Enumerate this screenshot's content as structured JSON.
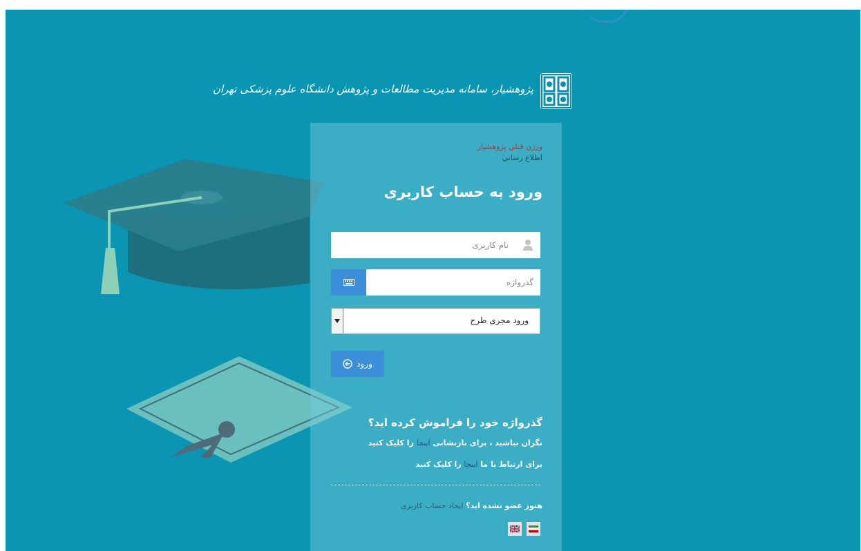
{
  "header": {
    "site_title": "پژوهشیار، سامانه مدیریت مطالعات و پژوهش دانشگاه علوم پزشکی تهران",
    "logo_icon": "university-logo-icon"
  },
  "login": {
    "previous_version_link": "ورژن قبلی پژوهشیار",
    "info_link": "اطلاع رسانی",
    "title": "ورود به حساب کاربری",
    "username_placeholder": "نام کاربری",
    "password_placeholder": "گذرواژه",
    "role_select_value": "ورود مجری طرح",
    "submit_label": "ورود"
  },
  "forgot": {
    "title": "گذرواژه خود را فراموش کرده اید؟",
    "restore_prefix": "نگران نباشید ، برای بازنشانی ",
    "restore_link": "اینجا",
    "restore_suffix": " را کلیک کنید",
    "contact_prefix": "برای ارتباط با ما ",
    "contact_link": "اینجا",
    "contact_suffix": " را کلیک کنید"
  },
  "register": {
    "prompt": "هنوز عضو نشده اید؟ ",
    "link": "ایجاد حساب کاربری"
  },
  "languages": {
    "persian_icon": "iran-flag-icon",
    "english_icon": "uk-flag-icon"
  },
  "colors": {
    "background": "#0a96b2",
    "panel": "rgba(120,205,222,0.45)",
    "primary_button": "#3a8fd8",
    "alert_link": "#e02020"
  }
}
